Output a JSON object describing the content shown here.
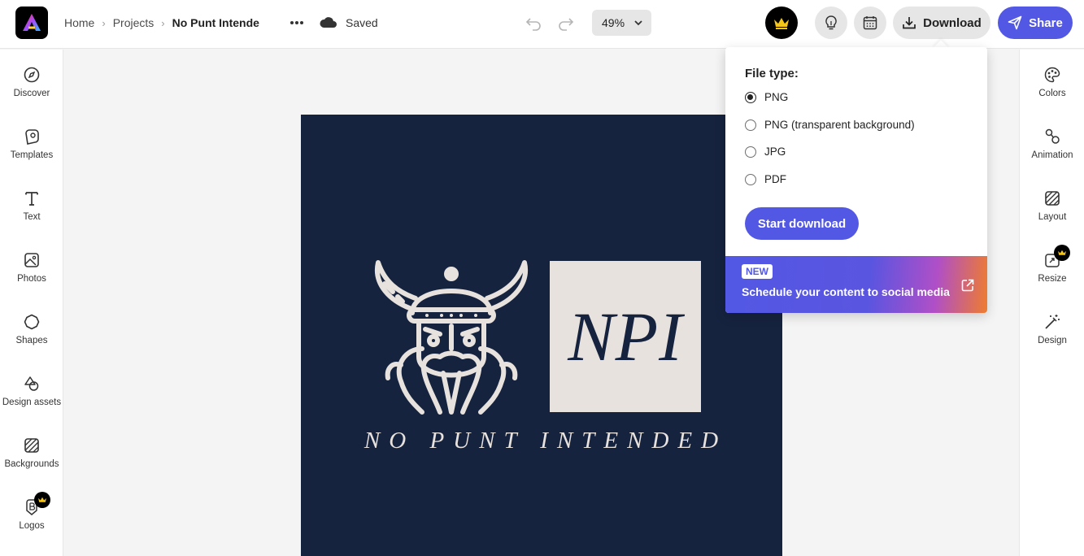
{
  "header": {
    "app_logo": "adobe-express-logo",
    "breadcrumbs": [
      "Home",
      "Projects",
      "No Punt Intende"
    ],
    "more_icon": "more-icon",
    "save_status": "Saved",
    "zoom_level": "49%",
    "download_label": "Download",
    "share_label": "Share"
  },
  "left_sidebar": {
    "items": [
      {
        "label": "Discover",
        "icon": "compass-icon"
      },
      {
        "label": "Templates",
        "icon": "templates-icon"
      },
      {
        "label": "Text",
        "icon": "text-icon"
      },
      {
        "label": "Photos",
        "icon": "photo-icon"
      },
      {
        "label": "Shapes",
        "icon": "shapes-icon"
      },
      {
        "label": "Design assets",
        "icon": "design-assets-icon"
      },
      {
        "label": "Backgrounds",
        "icon": "backgrounds-icon"
      },
      {
        "label": "Logos",
        "icon": "logos-icon",
        "premium": true
      }
    ]
  },
  "right_sidebar": {
    "items": [
      {
        "label": "Colors",
        "icon": "palette-icon"
      },
      {
        "label": "Animation",
        "icon": "animation-icon"
      },
      {
        "label": "Layout",
        "icon": "layout-icon"
      },
      {
        "label": "Resize",
        "icon": "resize-icon",
        "premium": true
      },
      {
        "label": "Design",
        "icon": "magic-wand-icon"
      }
    ]
  },
  "canvas": {
    "monogram": "NPI",
    "tagline": "NO PUNT INTENDED",
    "background_color": "#16233f",
    "accent_color": "#e7e2dd"
  },
  "download_popover": {
    "title": "File type:",
    "options": [
      {
        "label": "PNG",
        "selected": true
      },
      {
        "label": "PNG (transparent background)",
        "selected": false
      },
      {
        "label": "JPG",
        "selected": false
      },
      {
        "label": "PDF",
        "selected": false
      }
    ],
    "start_label": "Start download",
    "promo": {
      "badge": "NEW",
      "text": "Schedule your content to social media"
    }
  },
  "colors": {
    "primary": "#5258e4",
    "premium": "#f5c518"
  }
}
